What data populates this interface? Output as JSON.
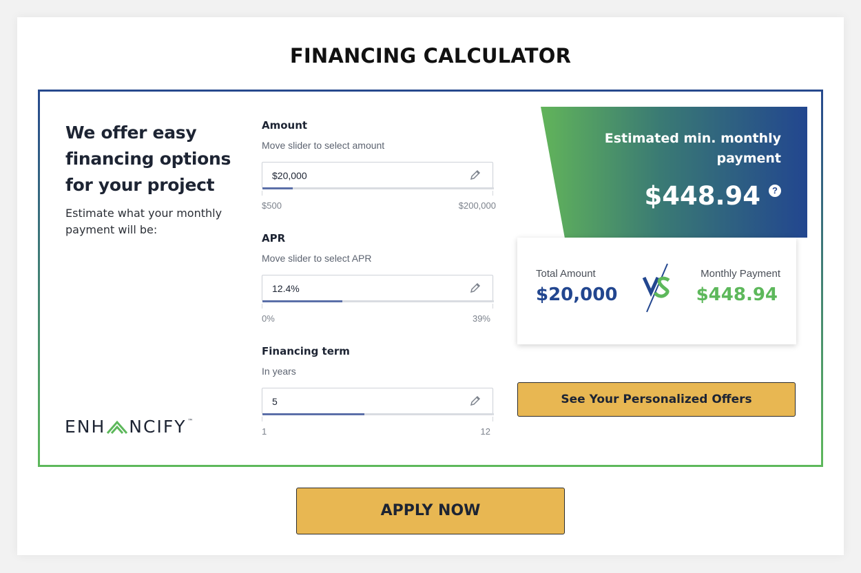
{
  "page": {
    "title": "FINANCING CALCULATOR"
  },
  "intro": {
    "heading": "We offer easy financing options for your project",
    "subtext": "Estimate what your monthly payment will be:"
  },
  "fields": {
    "amount": {
      "label": "Amount",
      "help": "Move slider to select amount",
      "value": "$20,000",
      "min": "$500",
      "max": "$200,000",
      "slider_fraction": 0.13
    },
    "apr": {
      "label": "APR",
      "help": "Move slider to select APR",
      "value": "12.4%",
      "min": "0%",
      "max": "39%",
      "slider_fraction": 0.345
    },
    "term": {
      "label": "Financing term",
      "help": "In years",
      "value": "5",
      "min": "1",
      "max": "12",
      "slider_fraction": 0.44
    }
  },
  "result": {
    "title": "Estimated min. monthly payment",
    "amount": "$448.94",
    "help_icon": "?"
  },
  "comparison": {
    "total_label": "Total Amount",
    "total_value": "$20,000",
    "monthly_label": "Monthly Payment",
    "monthly_value": "$448.94",
    "vs_icon": "vs-icon"
  },
  "buttons": {
    "offers": "See Your Personalized Offers",
    "apply": "APPLY NOW"
  },
  "logo": {
    "text_left": "ENH",
    "text_right": "NCIFY",
    "tm": "™"
  },
  "colors": {
    "navy": "#22468f",
    "green": "#5db85b",
    "gold": "#e8b752"
  }
}
